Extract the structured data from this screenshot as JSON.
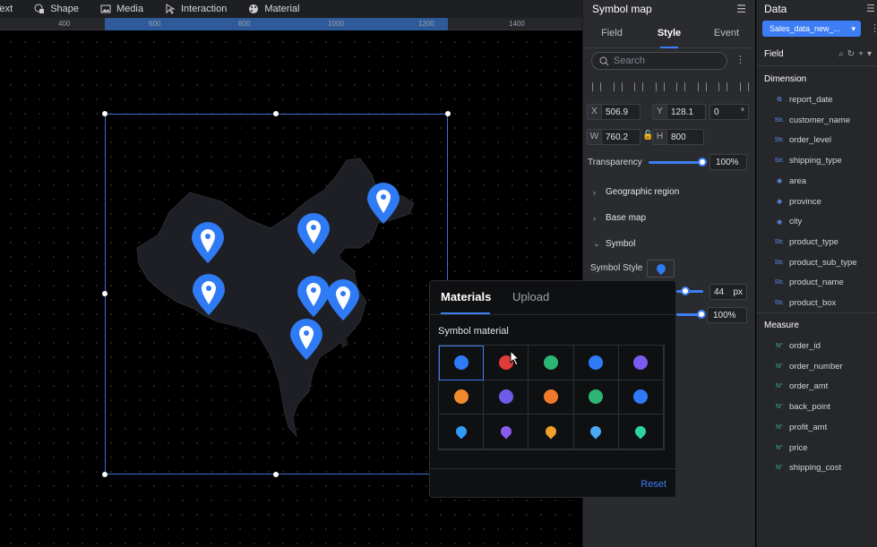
{
  "toolbar": {
    "items": [
      {
        "label": "Text",
        "icon": "text-icon"
      },
      {
        "label": "Shape",
        "icon": "shape-icon"
      },
      {
        "label": "Media",
        "icon": "image-icon"
      },
      {
        "label": "Interaction",
        "icon": "interaction-icon"
      },
      {
        "label": "Material",
        "icon": "palette-icon"
      }
    ]
  },
  "ruler": {
    "ticks": [
      "400",
      "600",
      "800",
      "1000",
      "1200",
      "1400"
    ]
  },
  "style_panel": {
    "title": "Symbol map",
    "tabs": [
      "Field",
      "Style",
      "Event"
    ],
    "active_tab": "Style",
    "search_placeholder": "Search",
    "x": "506.9",
    "y": "128.1",
    "rotation": "0",
    "rotation_unit": "°",
    "w": "760.2",
    "h": "800",
    "x_label": "X",
    "y_label": "Y",
    "w_label": "W",
    "h_label": "H",
    "transparency_label": "Transparency",
    "transparency_value": "100%",
    "transparency_level": 1.0,
    "sections": [
      "Geographic region",
      "Base map",
      "Symbol"
    ],
    "symbol_style_label": "Symbol Style",
    "size_value": "44",
    "size_unit": "px",
    "opacity_value": "100%"
  },
  "data_panel": {
    "title": "Data",
    "dataset": "Sales_data_new_...",
    "field_label": "Field",
    "dimension_label": "Dimension",
    "dimensions": [
      {
        "name": "report_date",
        "type": "date"
      },
      {
        "name": "customer_name",
        "type": "Str."
      },
      {
        "name": "order_level",
        "type": "Str."
      },
      {
        "name": "shipping_type",
        "type": "Str."
      },
      {
        "name": "area",
        "type": "geo"
      },
      {
        "name": "province",
        "type": "geo"
      },
      {
        "name": "city",
        "type": "geo"
      },
      {
        "name": "product_type",
        "type": "Str."
      },
      {
        "name": "product_sub_type",
        "type": "Str."
      },
      {
        "name": "product_name",
        "type": "Str."
      },
      {
        "name": "product_box",
        "type": "Str."
      }
    ],
    "measure_label": "Measure",
    "measures": [
      "order_id",
      "order_number",
      "order_amt",
      "back_point",
      "profit_amt",
      "price",
      "shipping_cost"
    ],
    "measure_type": "N°"
  },
  "popup": {
    "tabs": [
      "Materials",
      "Upload"
    ],
    "active_tab": "Materials",
    "subtitle": "Symbol material",
    "reset_label": "Reset",
    "icons": [
      {
        "name": "pin-icon",
        "color": "#2f7bf5"
      },
      {
        "name": "warning-icon",
        "color": "#e23b3b"
      },
      {
        "name": "shield-icon",
        "color": "#2db673"
      },
      {
        "name": "plane-icon",
        "color": "#2f7bf5"
      },
      {
        "name": "truck-icon",
        "color": "#7b5bf0"
      },
      {
        "name": "shop-icon",
        "color": "#f08a2b"
      },
      {
        "name": "building-icon",
        "color": "#6c5ce7"
      },
      {
        "name": "store-icon",
        "color": "#f07a2b"
      },
      {
        "name": "train-icon",
        "color": "#2db673"
      },
      {
        "name": "tower-icon",
        "color": "#2f7bf5"
      },
      {
        "name": "location-blue-icon",
        "color": "#2f9bf5"
      },
      {
        "name": "location-purple-icon",
        "color": "#8a5cf0"
      },
      {
        "name": "location-orange-icon",
        "color": "#f0a02b"
      },
      {
        "name": "location-lightblue-icon",
        "color": "#4aa8f5"
      },
      {
        "name": "location-teal-icon",
        "color": "#2dd4a0"
      }
    ]
  },
  "map": {
    "pin_color": "#2f7bf5",
    "pin_count": 7
  }
}
